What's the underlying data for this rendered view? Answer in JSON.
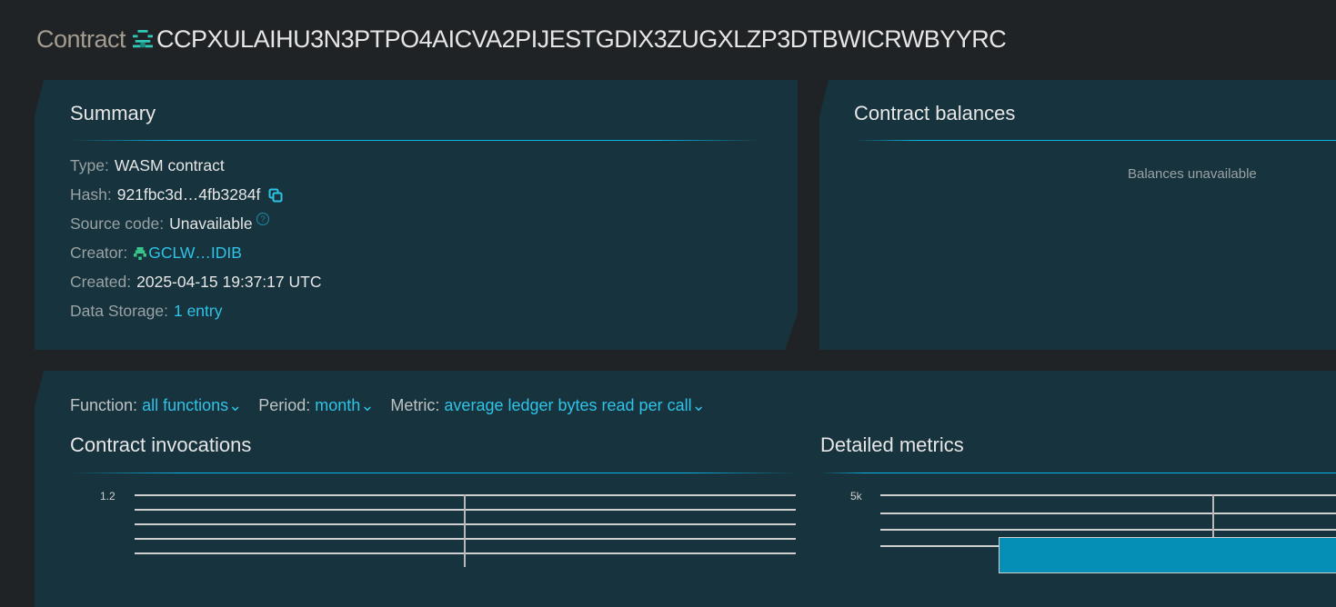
{
  "header": {
    "label": "Contract",
    "contract_id": "CCPXULAIHU3N3PTPO4AICVA2PIJESTGDIX3ZUGXLZP3DTBWICRWBYYRC",
    "identicon": "contract-identicon-icon"
  },
  "summary": {
    "title": "Summary",
    "rows": [
      {
        "label": "Type:",
        "value": "WASM contract"
      },
      {
        "label": "Hash:",
        "value": "921fbc3d…4fb3284f"
      },
      {
        "label": "Source code:",
        "value": "Unavailable"
      },
      {
        "label": "Creator:",
        "value": "GCLW…IDIB"
      },
      {
        "label": "Created:",
        "value": "2025-04-15 19:37:17 UTC"
      },
      {
        "label": "Data Storage:",
        "value": "1 entry"
      }
    ]
  },
  "balances": {
    "title": "Contract balances",
    "empty": "Balances unavailable"
  },
  "filters": {
    "function_label": "Function:",
    "function_value": "all functions",
    "period_label": "Period:",
    "period_value": "month",
    "metric_label": "Metric:",
    "metric_value": "average ledger bytes read per call"
  },
  "invocations": {
    "title": "Contract invocations"
  },
  "metrics": {
    "title": "Detailed metrics"
  },
  "chart_data": [
    {
      "type": "line",
      "title": "Contract invocations",
      "y_ticks_visible": [
        "1.2"
      ]
    },
    {
      "type": "bar",
      "title": "Detailed metrics",
      "y_ticks_visible": [
        "5k"
      ]
    }
  ],
  "colors": {
    "accent": "#08b5e5",
    "card": "#17333d",
    "bar": "#058fb6"
  }
}
